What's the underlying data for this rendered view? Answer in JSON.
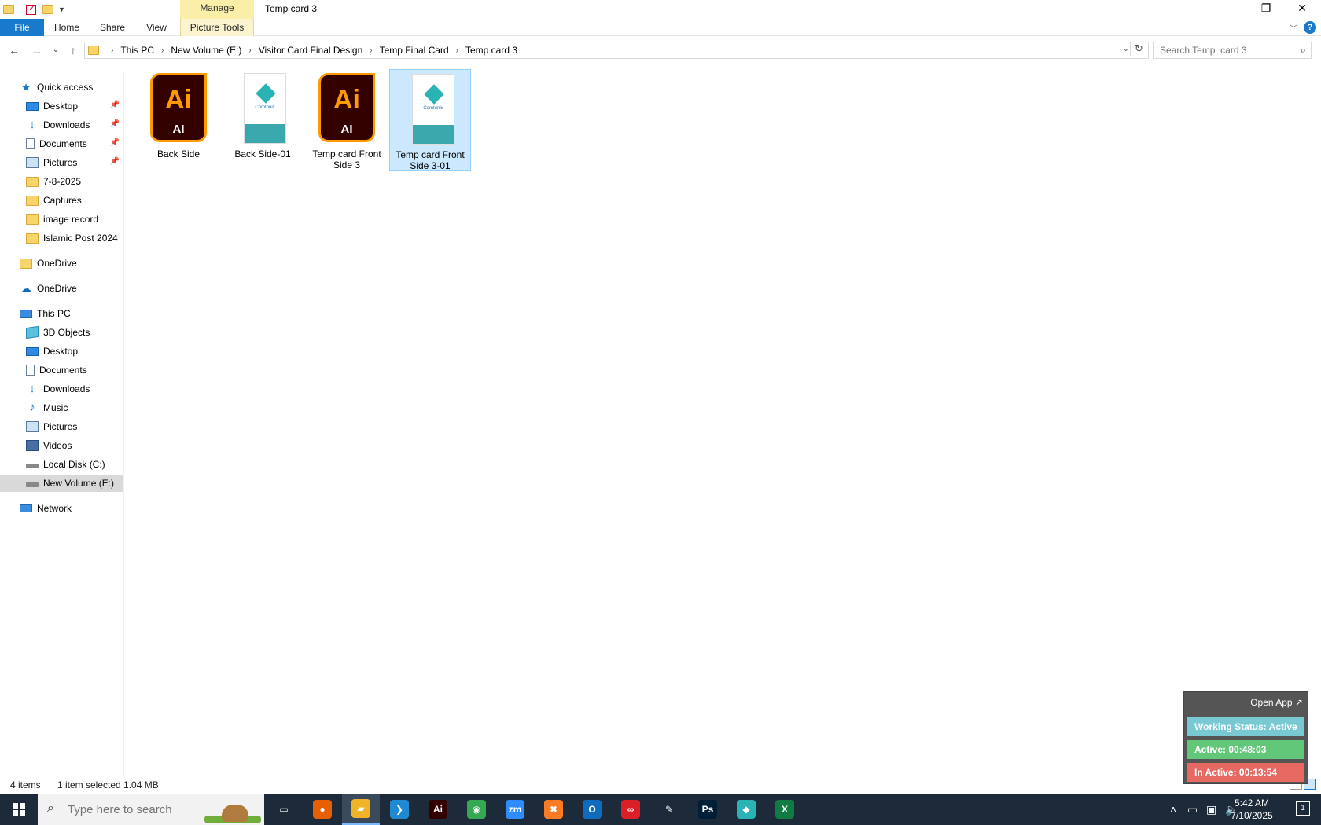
{
  "window": {
    "title": "Temp  card 3",
    "manage_tab": "Manage",
    "minimize": "—",
    "restore": "❐",
    "close": "✕"
  },
  "ribbon": {
    "tabs": [
      "File",
      "Home",
      "Share",
      "View",
      "Picture Tools"
    ],
    "help": "?"
  },
  "address": {
    "crumbs": [
      "This PC",
      "New Volume (E:)",
      "Visitor Card Final Design",
      "Temp Final Card",
      "Temp  card 3"
    ],
    "search_placeholder": "Search Temp  card 3"
  },
  "sidebar": {
    "quick_access": "Quick access",
    "quick_items": [
      "Desktop",
      "Downloads",
      "Documents",
      "Pictures",
      "7-8-2025",
      "Captures",
      "image record",
      "Islamic Post 2024"
    ],
    "onedrive_folder": "OneDrive",
    "onedrive_cloud": "OneDrive",
    "this_pc": "This PC",
    "pc_items": [
      "3D Objects",
      "Desktop",
      "Documents",
      "Downloads",
      "Music",
      "Pictures",
      "Videos",
      "Local Disk (C:)",
      "New Volume (E:)"
    ],
    "network": "Network"
  },
  "files": [
    {
      "name": "Back Side",
      "type": "ai",
      "icon_top": "Ai",
      "icon_bottom": "AI"
    },
    {
      "name": "Back Side-01",
      "type": "card",
      "logo_text": "Comtonix"
    },
    {
      "name": "Temp  card Front Side 3",
      "type": "ai",
      "icon_top": "Ai",
      "icon_bottom": "AI"
    },
    {
      "name": "Temp  card Front Side 3-01",
      "type": "card",
      "logo_text": "Comtonix",
      "selected": true
    }
  ],
  "status": {
    "items": "4 items",
    "selection": "1 item selected  1.04 MB"
  },
  "tracker": {
    "open_app": "Open App ↗",
    "working_status": "Working Status: Active",
    "active": "Active: 00:48:03",
    "inactive": "In Active: 00:13:54"
  },
  "taskbar": {
    "search_placeholder": "Type here to search",
    "apps": [
      {
        "name": "Task View",
        "glyph": "▭",
        "color": "#1c2a3a"
      },
      {
        "name": "Firefox",
        "glyph": "●",
        "color": "#e66000"
      },
      {
        "name": "File Explorer",
        "glyph": "▰",
        "color": "#f0b429"
      },
      {
        "name": "VS Code",
        "glyph": "❯",
        "color": "#1f8ad2"
      },
      {
        "name": "Illustrator",
        "glyph": "Ai",
        "color": "#330000"
      },
      {
        "name": "Chrome",
        "glyph": "◉",
        "color": "#34a853"
      },
      {
        "name": "Zoom",
        "glyph": "zm",
        "color": "#2d8cff"
      },
      {
        "name": "XAMPP",
        "glyph": "✖",
        "color": "#fb7a24"
      },
      {
        "name": "Outlook",
        "glyph": "O",
        "color": "#0f6cbd"
      },
      {
        "name": "Creative Cloud",
        "glyph": "∞",
        "color": "#da1f26"
      },
      {
        "name": "Pen Tool",
        "glyph": "✎",
        "color": "#1c2a3a"
      },
      {
        "name": "Photoshop",
        "glyph": "Ps",
        "color": "#001e36"
      },
      {
        "name": "App",
        "glyph": "◆",
        "color": "#2ab3b5"
      },
      {
        "name": "Excel",
        "glyph": "X",
        "color": "#107c41"
      }
    ],
    "time": "5:42 AM",
    "date": "7/10/2025",
    "notifications": "1"
  },
  "colors": {
    "accent": "#1979ca",
    "selection": "#cce8ff",
    "manage": "#fbeea9",
    "tracker_status": "#79c9d3",
    "tracker_active": "#63c77a",
    "tracker_inactive": "#e66a62"
  }
}
